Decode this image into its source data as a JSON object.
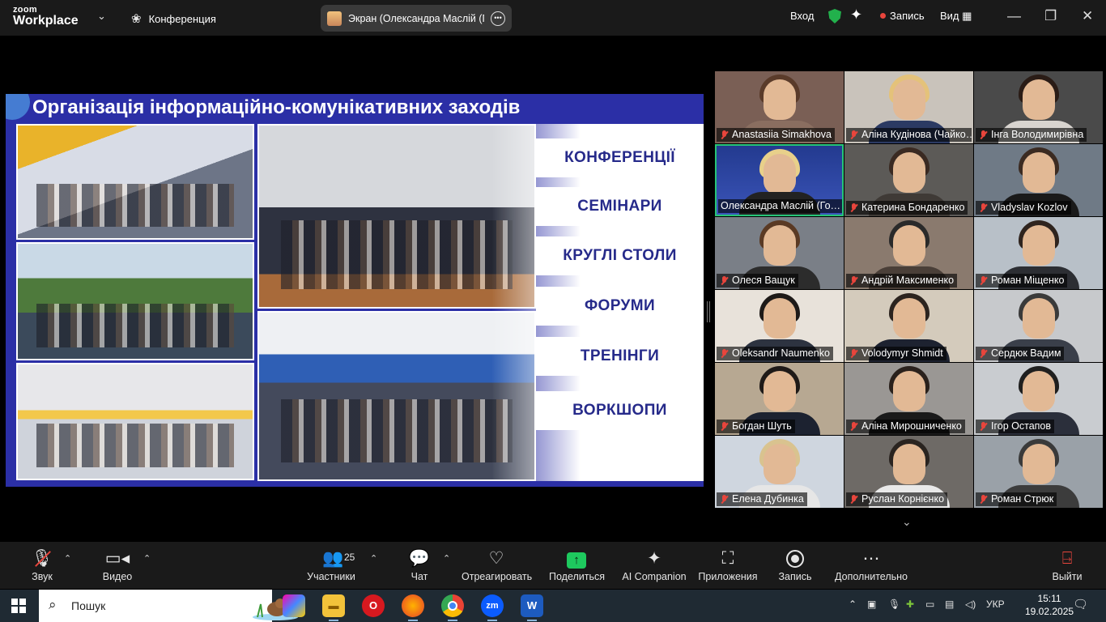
{
  "titlebar": {
    "logo_top": "zoom",
    "logo_bottom": "Workplace",
    "meeting_name": "Конференция",
    "share_label": "Экран (Олександра Маслій (Го…",
    "signin": "Вход",
    "record": "Запись",
    "view": "Вид"
  },
  "slide": {
    "title": "Організація інформаційно-комунікативних заходів",
    "topics": [
      "КОНФЕРЕНЦІЇ",
      "СЕМІНАРИ",
      "КРУГЛІ СТОЛИ",
      "ФОРУМИ",
      "ТРЕНІНГИ",
      "ВОРКШОПИ"
    ]
  },
  "participants": [
    {
      "name": "Anastasiia Simakhova",
      "muted": true,
      "active": false
    },
    {
      "name": "Аліна Кудінова (Чайко…",
      "muted": true,
      "active": false
    },
    {
      "name": "Інга Володимирівна",
      "muted": true,
      "active": false
    },
    {
      "name": "Олександра Маслій (Го…",
      "muted": false,
      "active": true
    },
    {
      "name": "Катерина Бондаренко",
      "muted": true,
      "active": false
    },
    {
      "name": "Vladyslav Kozlov",
      "muted": true,
      "active": false
    },
    {
      "name": "Олеся Ващук",
      "muted": true,
      "active": false
    },
    {
      "name": "Андрій Максименко",
      "muted": true,
      "active": false
    },
    {
      "name": "Роман Міщенко",
      "muted": true,
      "active": false
    },
    {
      "name": "Oleksandr Naumenko",
      "muted": true,
      "active": false
    },
    {
      "name": "Volodymyr Shmidt",
      "muted": true,
      "active": false
    },
    {
      "name": "Сердюк Вадим",
      "muted": true,
      "active": false
    },
    {
      "name": "Богдан Шуть",
      "muted": true,
      "active": false
    },
    {
      "name": "Аліна Мирошниченко",
      "muted": true,
      "active": false
    },
    {
      "name": "Ігор Остапов",
      "muted": true,
      "active": false
    },
    {
      "name": "Елена Дубинка",
      "muted": true,
      "active": false
    },
    {
      "name": "Руслан Корнієнко",
      "muted": true,
      "active": false
    },
    {
      "name": "Роман Стрюк",
      "muted": true,
      "active": false
    }
  ],
  "toolbar": {
    "audio": "Звук",
    "video": "Видео",
    "participants": "Участники",
    "participants_count": "25",
    "chat": "Чат",
    "react": "Отреагировать",
    "share": "Поделиться",
    "ai": "AI Companion",
    "apps": "Приложения",
    "record": "Запись",
    "more": "Дополнительно",
    "leave": "Выйти"
  },
  "taskbar": {
    "search_placeholder": "Пошук",
    "apps": [
      "copilot-icon",
      "file-explorer-icon",
      "opera-icon",
      "firefox-icon",
      "chrome-icon",
      "zoom-icon",
      "word-icon"
    ],
    "lang": "УКР",
    "time": "15:11",
    "date": "19.02.2025"
  },
  "colors": {
    "slide_blue": "#2b2fa6",
    "active_speaker": "#27c477",
    "share_green": "#1ec95e",
    "recording_red": "#e8453c"
  }
}
